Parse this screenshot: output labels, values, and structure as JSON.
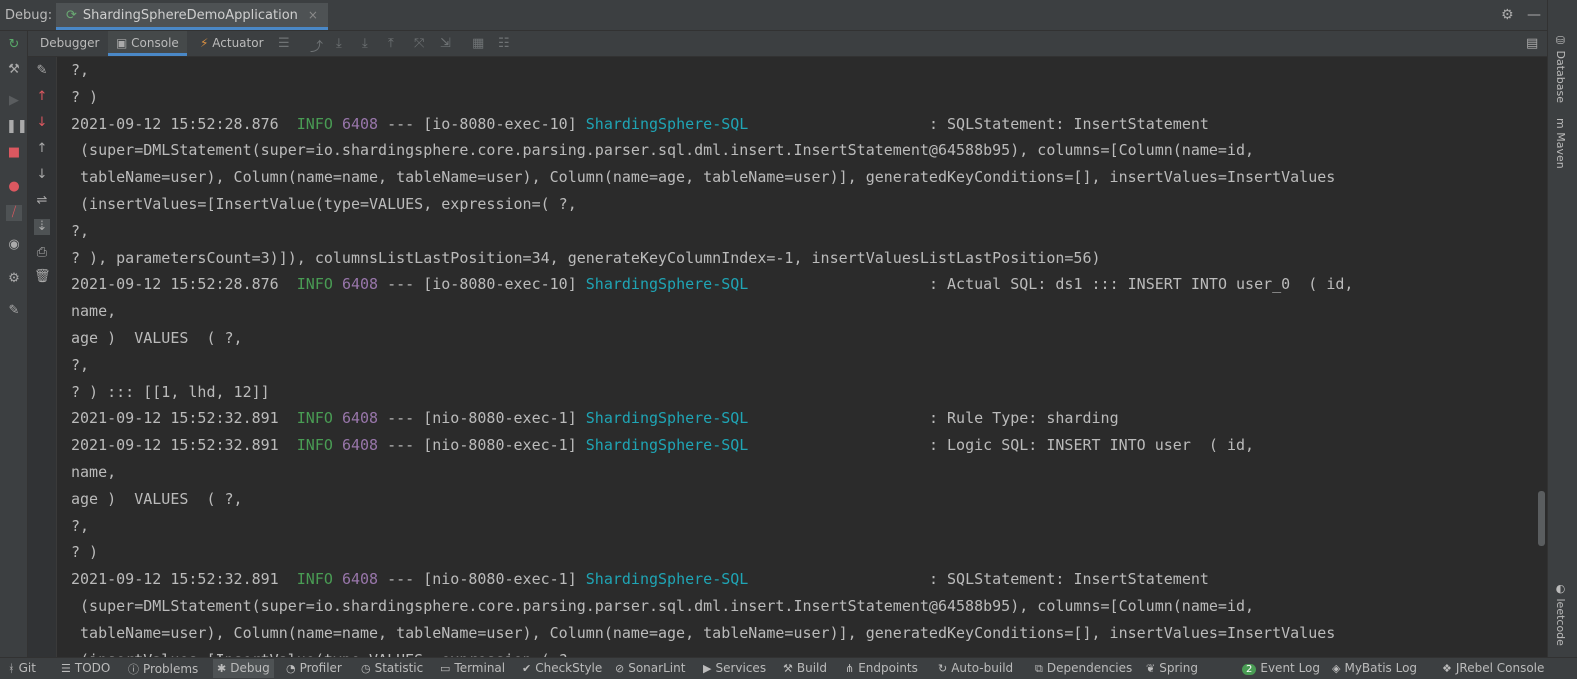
{
  "titlebar": {
    "label": "Debug:",
    "run_tab": "ShardingSphereDemoApplication",
    "close_glyph": "×",
    "settings_icon": "⚙",
    "minimize_icon": "—"
  },
  "toolbar": {
    "tabs": [
      {
        "label": "Debugger"
      },
      {
        "label": "Console"
      },
      {
        "label": "Actuator"
      }
    ]
  },
  "right_bar": {
    "database": "Database",
    "maven": "Maven",
    "leetcode": "leetcode"
  },
  "console": {
    "lines": [
      {
        "text": "?,"
      },
      {
        "text": "? )"
      },
      {
        "ts": "2021-09-12 15:52:28.876",
        "level": "INFO",
        "pid": "6408",
        "thread": " --- [io-8080-exec-10] ",
        "logger": "ShardingSphere-SQL",
        "msg": "                    : SQLStatement: InsertStatement"
      },
      {
        "text": " (super=DMLStatement(super=io.shardingsphere.core.parsing.parser.sql.dml.insert.InsertStatement@64588b95), columns=[Column(name=id,"
      },
      {
        "text": " tableName=user), Column(name=name, tableName=user), Column(name=age, tableName=user)], generatedKeyConditions=[], insertValues=InsertValues"
      },
      {
        "text": " (insertValues=[InsertValue(type=VALUES, expression=( ?,"
      },
      {
        "text": "?,"
      },
      {
        "text": "? ), parametersCount=3)]), columnsListLastPosition=34, generateKeyColumnIndex=-1, insertValuesListLastPosition=56)"
      },
      {
        "ts": "2021-09-12 15:52:28.876",
        "level": "INFO",
        "pid": "6408",
        "thread": " --- [io-8080-exec-10] ",
        "logger": "ShardingSphere-SQL",
        "msg": "                    : Actual SQL: ds1 ::: INSERT INTO user_0  ( id,"
      },
      {
        "text": "name,"
      },
      {
        "text": "age )  VALUES  ( ?,"
      },
      {
        "text": "?,"
      },
      {
        "text": "? ) ::: [[1, lhd, 12]]"
      },
      {
        "ts": "2021-09-12 15:52:32.891",
        "level": "INFO",
        "pid": "6408",
        "thread": " --- [nio-8080-exec-1] ",
        "logger": "ShardingSphere-SQL",
        "msg": "                    : Rule Type: sharding"
      },
      {
        "ts": "2021-09-12 15:52:32.891",
        "level": "INFO",
        "pid": "6408",
        "thread": " --- [nio-8080-exec-1] ",
        "logger": "ShardingSphere-SQL",
        "msg": "                    : Logic SQL: INSERT INTO user  ( id,"
      },
      {
        "text": "name,"
      },
      {
        "text": "age )  VALUES  ( ?,"
      },
      {
        "text": "?,"
      },
      {
        "text": "? )"
      },
      {
        "ts": "2021-09-12 15:52:32.891",
        "level": "INFO",
        "pid": "6408",
        "thread": " --- [nio-8080-exec-1] ",
        "logger": "ShardingSphere-SQL",
        "msg": "                    : SQLStatement: InsertStatement"
      },
      {
        "text": " (super=DMLStatement(super=io.shardingsphere.core.parsing.parser.sql.dml.insert.InsertStatement@64588b95), columns=[Column(name=id,"
      },
      {
        "text": " tableName=user), Column(name=name, tableName=user), Column(name=age, tableName=user)], generatedKeyConditions=[], insertValues=InsertValues"
      },
      {
        "text": " (insertValues=[InsertValue(type=VALUES, expression=( ?,"
      }
    ]
  },
  "statusbar": {
    "items": [
      {
        "label": "Git",
        "icon": "git-icon"
      },
      {
        "label": "TODO",
        "icon": "todo-icon"
      },
      {
        "label": "Problems",
        "icon": "problems-icon"
      },
      {
        "label": "Debug",
        "icon": "debug-icon"
      },
      {
        "label": "Profiler",
        "icon": "profiler-icon"
      },
      {
        "label": "Statistic",
        "icon": "statistic-icon"
      },
      {
        "label": "Terminal",
        "icon": "terminal-icon"
      },
      {
        "label": "CheckStyle",
        "icon": "checkstyle-icon"
      },
      {
        "label": "SonarLint",
        "icon": "sonarlint-icon"
      },
      {
        "label": "Services",
        "icon": "services-icon"
      },
      {
        "label": "Build",
        "icon": "build-icon"
      },
      {
        "label": "Endpoints",
        "icon": "endpoints-icon"
      },
      {
        "label": "Auto-build",
        "icon": "autobuild-icon"
      },
      {
        "label": "Dependencies",
        "icon": "dependencies-icon"
      },
      {
        "label": "Spring",
        "icon": "spring-icon"
      },
      {
        "label": "Event Log",
        "icon": "event-log-icon",
        "badge": "2"
      },
      {
        "label": "MyBatis Log",
        "icon": "mybatis-icon"
      },
      {
        "label": "JRebel Console",
        "icon": "jrebel-icon"
      }
    ]
  },
  "colors": {
    "background": "#2b2b2b",
    "panel": "#3c3f41",
    "info": "#499c54",
    "pid": "#9876aa",
    "logger": "#1fa5b5",
    "accent": "#4a88c7"
  }
}
